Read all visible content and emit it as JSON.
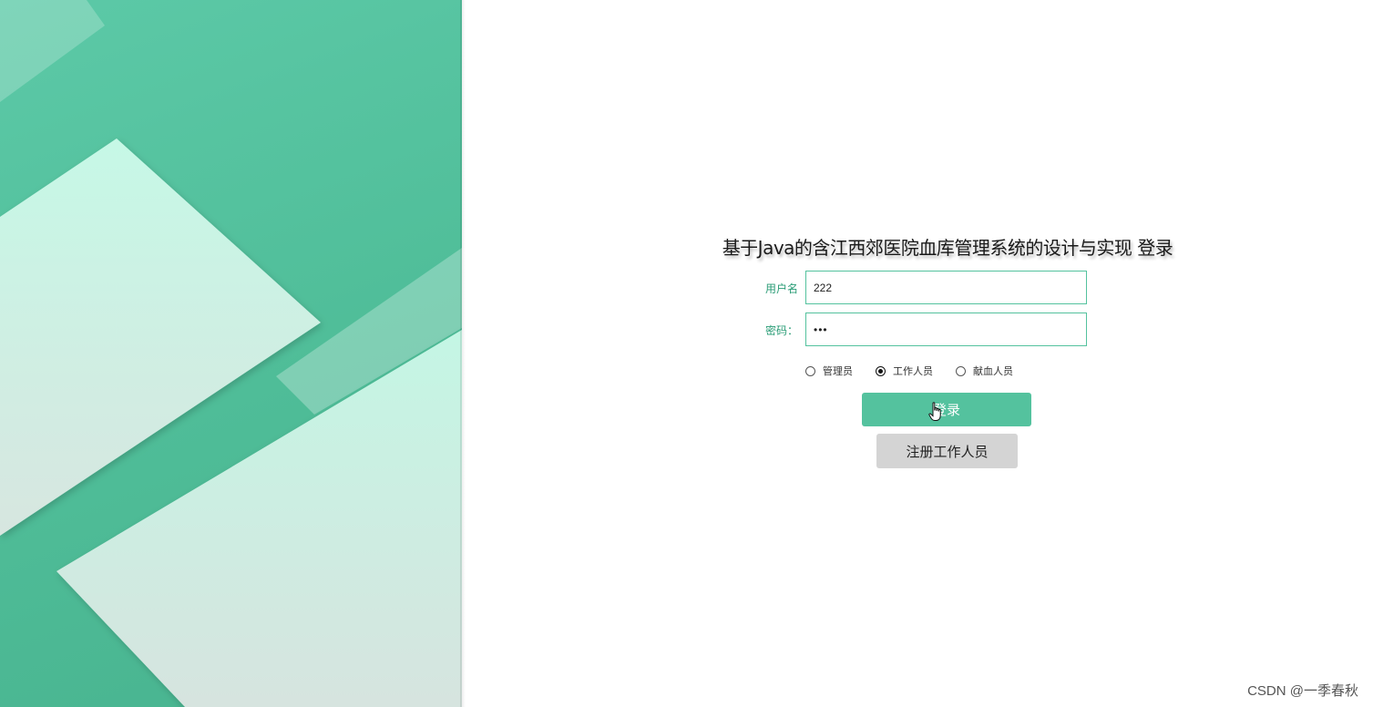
{
  "login": {
    "title": "基于Java的含江西郊医院血库管理系统的设计与实现 登录",
    "username_label": "用户名",
    "username_value": "222",
    "password_label": "密码：",
    "password_value": "•••",
    "roles": [
      {
        "label": "管理员",
        "selected": false
      },
      {
        "label": "工作人员",
        "selected": true
      },
      {
        "label": "献血人员",
        "selected": false
      }
    ],
    "login_button": "登录",
    "register_button": "注册工作人员"
  },
  "watermark": "CSDN @一季春秋",
  "colors": {
    "accent": "#54c29e",
    "panel": "#4fbd98",
    "register_bg": "#d4d4d4"
  },
  "icons": {
    "cursor": "hand-pointer-icon"
  }
}
